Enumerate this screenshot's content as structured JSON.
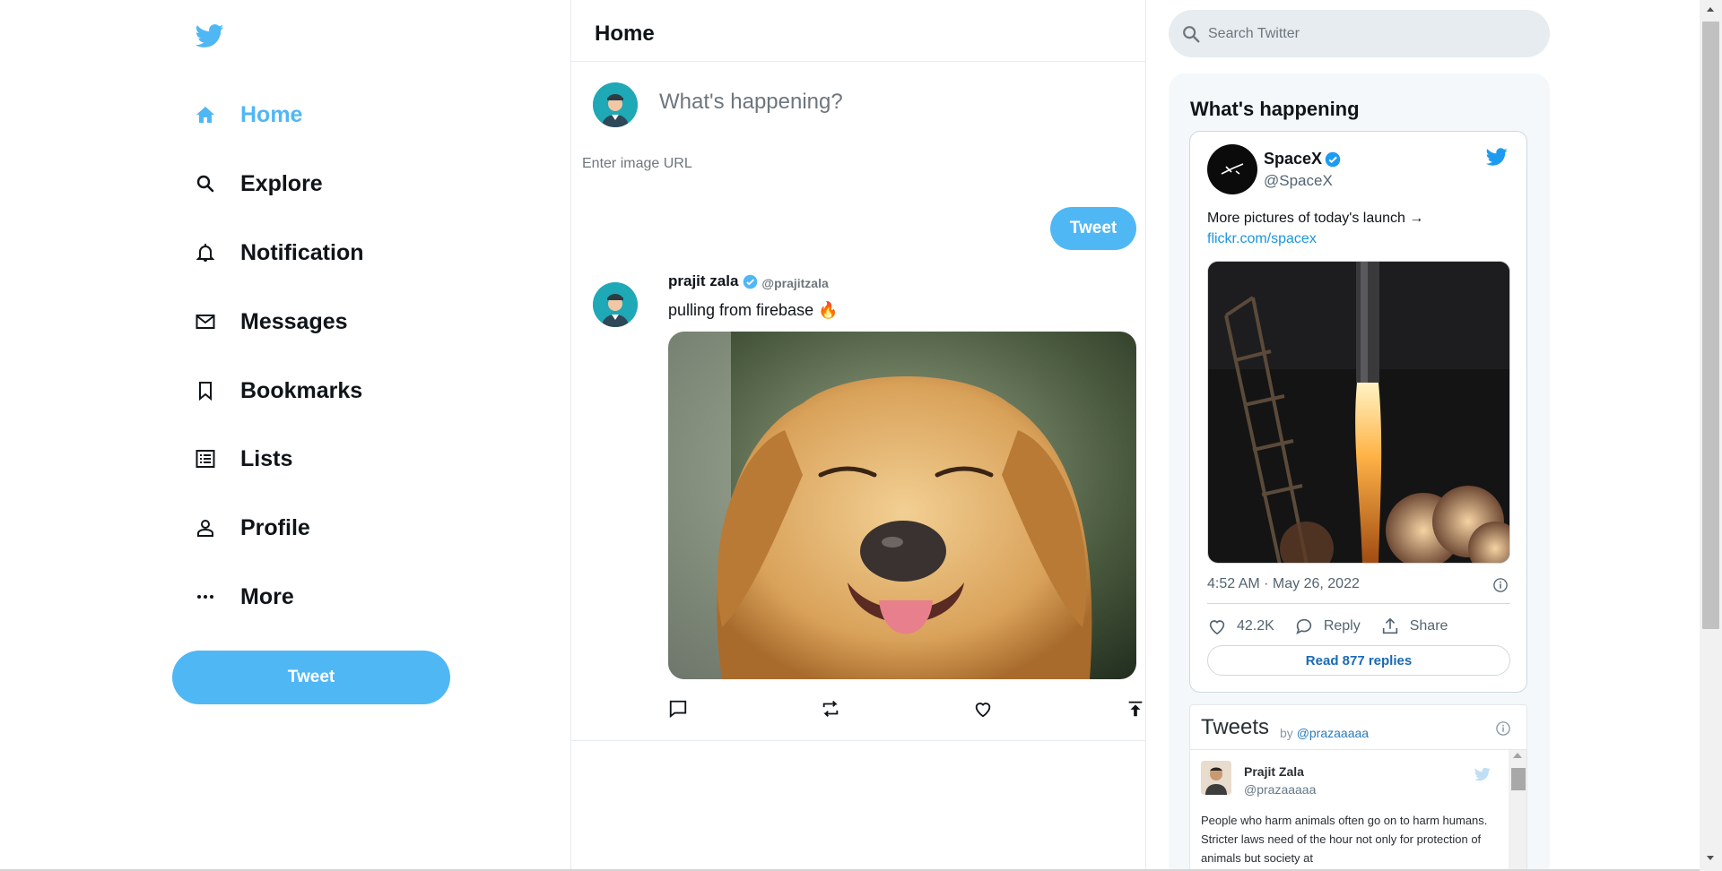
{
  "colors": {
    "accent": "#50b7f5",
    "link": "#1b95e0",
    "text": "#0f1419",
    "muted": "#6e767d"
  },
  "sidebar": {
    "logo_icon": "twitter-bird-icon",
    "items": [
      {
        "label": "Home",
        "icon": "home-icon",
        "active": true
      },
      {
        "label": "Explore",
        "icon": "search-icon"
      },
      {
        "label": "Notification",
        "icon": "bell-icon"
      },
      {
        "label": "Messages",
        "icon": "mail-icon"
      },
      {
        "label": "Bookmarks",
        "icon": "bookmark-icon"
      },
      {
        "label": "Lists",
        "icon": "list-icon"
      },
      {
        "label": "Profile",
        "icon": "person-icon"
      },
      {
        "label": "More",
        "icon": "more-icon"
      }
    ],
    "tweet_button": "Tweet"
  },
  "feed": {
    "title": "Home",
    "compose": {
      "placeholder": "What's happening?",
      "image_url_placeholder": "Enter image URL",
      "tweet_button": "Tweet"
    },
    "posts": [
      {
        "display_name": "prajit zala",
        "username": "@prajitzala",
        "verified": true,
        "text": "pulling from firebase 🔥",
        "image": "golden-retriever-photo",
        "actions": [
          "comment-icon",
          "retweet-icon",
          "like-icon",
          "publish-icon"
        ]
      }
    ]
  },
  "widgets": {
    "search_placeholder": "Search Twitter",
    "title": "What's happening",
    "embed": {
      "name": "SpaceX",
      "handle": "@SpaceX",
      "text": "More pictures of today's launch →",
      "link": "flickr.com/spacex",
      "image": "rocket-launch-photo",
      "timestamp": "4:52 AM · May 26, 2022",
      "likes": "42.2K",
      "reply_label": "Reply",
      "share_label": "Share",
      "read_replies": "Read 877 replies"
    },
    "timeline": {
      "title": "Tweets",
      "by_prefix": "by",
      "by_handle": "@prazaaaaa",
      "tweet": {
        "name": "Prajit Zala",
        "handle": "@prazaaaaa",
        "text": "People who harm animals often go on to harm humans. Stricter laws need of the hour not only for protection of animals but society at"
      }
    }
  }
}
